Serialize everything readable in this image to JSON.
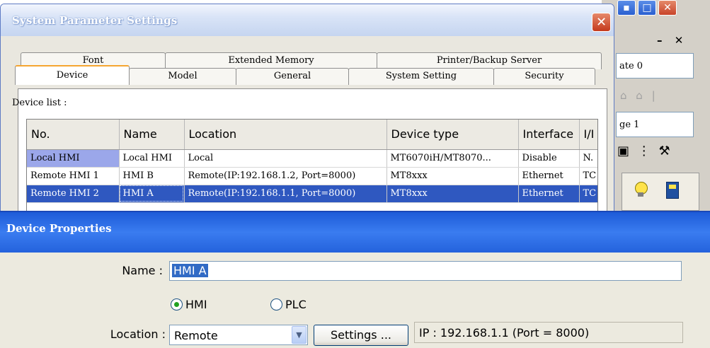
{
  "background_app": {
    "panel1_text": "ate 0",
    "panel2_text": "ge 1"
  },
  "system_parameter_settings": {
    "title": "System Parameter Settings",
    "tabs_back": [
      "Font",
      "Extended Memory",
      "Printer/Backup Server"
    ],
    "tabs_front": [
      "Device",
      "Model",
      "General",
      "System Setting",
      "Security"
    ],
    "active_tab": "Device",
    "device_list_label": "Device list :",
    "columns": [
      "No.",
      "Name",
      "Location",
      "Device type",
      "Interface",
      "I/I"
    ],
    "rows": [
      {
        "no": "Local HMI",
        "name": "Local HMI",
        "location": "Local",
        "device_type": "MT6070iH/MT8070...",
        "interface": "Disable",
        "io": "N."
      },
      {
        "no": "Remote HMI 1",
        "name": "HMI B",
        "location": "Remote(IP:192.168.1.2, Port=8000)",
        "device_type": "MT8xxx",
        "interface": "Ethernet",
        "io": "TC"
      },
      {
        "no": "Remote HMI 2",
        "name": "HMI A",
        "location": "Remote(IP:192.168.1.1, Port=8000)",
        "device_type": "MT8xxx",
        "interface": "Ethernet",
        "io": "TC"
      }
    ]
  },
  "device_properties": {
    "title": "Device Properties",
    "name_label": "Name :",
    "name_value": "HMI A",
    "radio_hmi": "HMI",
    "radio_plc": "PLC",
    "selected_type": "HMI",
    "location_label": "Location :",
    "location_value": "Remote",
    "settings_button": "Settings ...",
    "ip_text": "IP : 192.168.1.1 (Port = 8000)"
  }
}
